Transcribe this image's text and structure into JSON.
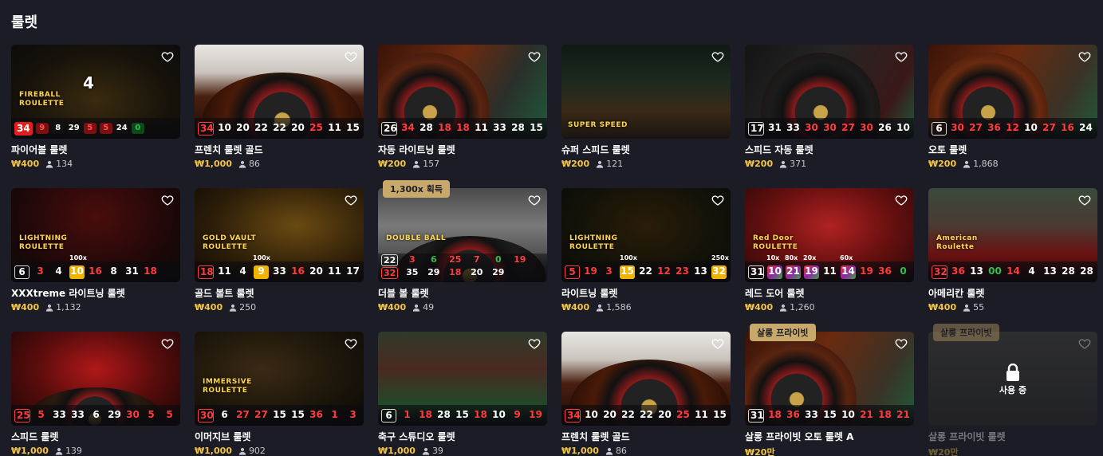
{
  "section_title": "룰렛",
  "colors": {
    "accent_gold": "#f4c542",
    "background": "#1b1c25",
    "red_number": "#ff3b3b",
    "green_number": "#2fbf4a"
  },
  "icons": {
    "favorite": "heart-outline-icon",
    "players": "user-icon",
    "lock": "lock-icon"
  },
  "games": [
    {
      "name": "파이어볼 룰렛",
      "price": "₩400",
      "players": "134",
      "results": [
        {
          "v": "34",
          "c": "redfill"
        },
        {
          "v": "9",
          "c": "red"
        },
        {
          "v": "8",
          "c": "black"
        },
        {
          "v": "29",
          "c": "black"
        },
        {
          "v": "5",
          "c": "red"
        },
        {
          "v": "5",
          "c": "red"
        },
        {
          "v": "24",
          "c": "black"
        },
        {
          "v": "0",
          "c": "green"
        }
      ],
      "thumb_text": [
        "FIREBALL",
        "ROULETTE",
        "4"
      ],
      "style": "boxed"
    },
    {
      "name": "프렌치 룰렛 골드",
      "price": "₩1,000",
      "players": "86",
      "results": [
        {
          "v": "34",
          "c": "red"
        },
        {
          "v": "10",
          "c": "black"
        },
        {
          "v": "20",
          "c": "black"
        },
        {
          "v": "22",
          "c": "black"
        },
        {
          "v": "22",
          "c": "black"
        },
        {
          "v": "20",
          "c": "black"
        },
        {
          "v": "25",
          "c": "red"
        },
        {
          "v": "11",
          "c": "black"
        },
        {
          "v": "15",
          "c": "black"
        }
      ]
    },
    {
      "name": "자동 라이트닝 룰렛",
      "price": "₩200",
      "players": "157",
      "results": [
        {
          "v": "26",
          "c": "black"
        },
        {
          "v": "34",
          "c": "red"
        },
        {
          "v": "28",
          "c": "black"
        },
        {
          "v": "18",
          "c": "red"
        },
        {
          "v": "18",
          "c": "red"
        },
        {
          "v": "11",
          "c": "black"
        },
        {
          "v": "33",
          "c": "black"
        },
        {
          "v": "28",
          "c": "black"
        },
        {
          "v": "15",
          "c": "black"
        }
      ]
    },
    {
      "name": "슈퍼 스피드 룰렛",
      "price": "₩200",
      "players": "121",
      "results": [],
      "thumb_text": [
        "SUPER SPEED"
      ]
    },
    {
      "name": "스피드 자동 룰렛",
      "price": "₩200",
      "players": "371",
      "results": [
        {
          "v": "17",
          "c": "black"
        },
        {
          "v": "31",
          "c": "black"
        },
        {
          "v": "33",
          "c": "black"
        },
        {
          "v": "30",
          "c": "red"
        },
        {
          "v": "30",
          "c": "red"
        },
        {
          "v": "27",
          "c": "red"
        },
        {
          "v": "30",
          "c": "red"
        },
        {
          "v": "26",
          "c": "black"
        },
        {
          "v": "10",
          "c": "black"
        }
      ]
    },
    {
      "name": "오토 룰렛",
      "price": "₩200",
      "players": "1,868",
      "results": [
        {
          "v": "6",
          "c": "black"
        },
        {
          "v": "30",
          "c": "red"
        },
        {
          "v": "27",
          "c": "red"
        },
        {
          "v": "36",
          "c": "red"
        },
        {
          "v": "12",
          "c": "red"
        },
        {
          "v": "10",
          "c": "black"
        },
        {
          "v": "27",
          "c": "red"
        },
        {
          "v": "16",
          "c": "red"
        },
        {
          "v": "24",
          "c": "black"
        }
      ]
    },
    {
      "name": "XXXtreme 라이트닝 룰렛",
      "price": "₩400",
      "players": "1,132",
      "results": [
        {
          "v": "6",
          "c": "black"
        },
        {
          "v": "3",
          "c": "red"
        },
        {
          "v": "4",
          "c": "black"
        },
        {
          "v": "10",
          "c": "gold",
          "m": "100x"
        },
        {
          "v": "16",
          "c": "red"
        },
        {
          "v": "8",
          "c": "black"
        },
        {
          "v": "31",
          "c": "black"
        },
        {
          "v": "18",
          "c": "red"
        }
      ],
      "thumb_text": [
        "LIGHTNING",
        "ROULETTE"
      ]
    },
    {
      "name": "골드 볼트 룰렛",
      "price": "₩400",
      "players": "250",
      "results": [
        {
          "v": "18",
          "c": "red"
        },
        {
          "v": "11",
          "c": "black"
        },
        {
          "v": "4",
          "c": "black"
        },
        {
          "v": "9",
          "c": "gold",
          "m": "100x"
        },
        {
          "v": "33",
          "c": "black"
        },
        {
          "v": "16",
          "c": "red"
        },
        {
          "v": "20",
          "c": "black"
        },
        {
          "v": "11",
          "c": "black"
        },
        {
          "v": "17",
          "c": "black"
        }
      ],
      "thumb_text": [
        "GOLD VAULT",
        "ROULETTE"
      ]
    },
    {
      "name": "더블 볼 룰렛",
      "price": "₩400",
      "players": "49",
      "badge": "1,300x 획득",
      "results_double": [
        [
          {
            "v": "22",
            "c": "black"
          },
          {
            "v": "3",
            "c": "red"
          },
          {
            "v": "6",
            "c": "green"
          },
          {
            "v": "25",
            "c": "red"
          },
          {
            "v": "7",
            "c": "red"
          },
          {
            "v": "0",
            "c": "green"
          },
          {
            "v": "19",
            "c": "red"
          }
        ],
        [
          {
            "v": "32",
            "c": "red"
          },
          {
            "v": "35",
            "c": "black"
          },
          {
            "v": "29",
            "c": "black"
          },
          {
            "v": "18",
            "c": "red"
          },
          {
            "v": "20",
            "c": "black"
          },
          {
            "v": "29",
            "c": "black"
          }
        ]
      ],
      "thumb_text": [
        "DOUBLE BALL"
      ]
    },
    {
      "name": "라이트닝 룰렛",
      "price": "₩400",
      "players": "1,586",
      "results": [
        {
          "v": "5",
          "c": "red"
        },
        {
          "v": "19",
          "c": "red"
        },
        {
          "v": "3",
          "c": "red"
        },
        {
          "v": "15",
          "c": "gold",
          "m": "100x"
        },
        {
          "v": "22",
          "c": "black"
        },
        {
          "v": "12",
          "c": "red"
        },
        {
          "v": "23",
          "c": "red"
        },
        {
          "v": "13",
          "c": "black"
        },
        {
          "v": "32",
          "c": "gold",
          "m": "250x"
        }
      ],
      "thumb_text": [
        "LIGHTNING",
        "ROULETTE"
      ]
    },
    {
      "name": "레드 도어 룰렛",
      "price": "₩400",
      "players": "1,260",
      "results": [
        {
          "v": "31",
          "c": "black"
        },
        {
          "v": "10",
          "c": "multi",
          "m": "10x"
        },
        {
          "v": "21",
          "c": "multi",
          "m": "80x"
        },
        {
          "v": "19",
          "c": "multi",
          "m": "20x"
        },
        {
          "v": "11",
          "c": "black"
        },
        {
          "v": "14",
          "c": "multi",
          "m": "60x"
        },
        {
          "v": "19",
          "c": "red"
        },
        {
          "v": "36",
          "c": "red"
        },
        {
          "v": "0",
          "c": "green"
        }
      ],
      "thumb_text": [
        "Red Door",
        "ROULETTE"
      ]
    },
    {
      "name": "아메리칸 룰렛",
      "price": "₩400",
      "players": "55",
      "results": [
        {
          "v": "32",
          "c": "red"
        },
        {
          "v": "36",
          "c": "red"
        },
        {
          "v": "13",
          "c": "black"
        },
        {
          "v": "00",
          "c": "green"
        },
        {
          "v": "14",
          "c": "red"
        },
        {
          "v": "4",
          "c": "black"
        },
        {
          "v": "13",
          "c": "black"
        },
        {
          "v": "28",
          "c": "black"
        },
        {
          "v": "28",
          "c": "black"
        }
      ],
      "thumb_text": [
        "American",
        "Roulette"
      ]
    },
    {
      "name": "스피드 룰렛",
      "price": "₩1,000",
      "players": "139",
      "results": [
        {
          "v": "25",
          "c": "red"
        },
        {
          "v": "5",
          "c": "red"
        },
        {
          "v": "33",
          "c": "black"
        },
        {
          "v": "33",
          "c": "black"
        },
        {
          "v": "6",
          "c": "black"
        },
        {
          "v": "29",
          "c": "black"
        },
        {
          "v": "30",
          "c": "red"
        },
        {
          "v": "5",
          "c": "red"
        },
        {
          "v": "5",
          "c": "red"
        }
      ]
    },
    {
      "name": "이머지브 룰렛",
      "price": "₩1,000",
      "players": "902",
      "results": [
        {
          "v": "30",
          "c": "red"
        },
        {
          "v": "6",
          "c": "black"
        },
        {
          "v": "27",
          "c": "red"
        },
        {
          "v": "27",
          "c": "red"
        },
        {
          "v": "15",
          "c": "black"
        },
        {
          "v": "15",
          "c": "black"
        },
        {
          "v": "36",
          "c": "red"
        },
        {
          "v": "1",
          "c": "red"
        },
        {
          "v": "3",
          "c": "red"
        }
      ],
      "thumb_text": [
        "IMMERSIVE",
        "ROULETTE"
      ]
    },
    {
      "name": "축구 스튜디오 룰렛",
      "price": "₩1,000",
      "players": "39",
      "results": [
        {
          "v": "6",
          "c": "black"
        },
        {
          "v": "1",
          "c": "red"
        },
        {
          "v": "18",
          "c": "red"
        },
        {
          "v": "28",
          "c": "black"
        },
        {
          "v": "15",
          "c": "black"
        },
        {
          "v": "18",
          "c": "red"
        },
        {
          "v": "10",
          "c": "black"
        },
        {
          "v": "9",
          "c": "red"
        },
        {
          "v": "19",
          "c": "red"
        }
      ]
    },
    {
      "name": "프렌치 룰렛 골드",
      "price": "₩1,000",
      "players": "86",
      "results": [
        {
          "v": "34",
          "c": "red"
        },
        {
          "v": "10",
          "c": "black"
        },
        {
          "v": "20",
          "c": "black"
        },
        {
          "v": "22",
          "c": "black"
        },
        {
          "v": "22",
          "c": "black"
        },
        {
          "v": "20",
          "c": "black"
        },
        {
          "v": "25",
          "c": "red"
        },
        {
          "v": "11",
          "c": "black"
        },
        {
          "v": "15",
          "c": "black"
        }
      ]
    },
    {
      "name": "살롱 프라이빗 오토 룰렛 A",
      "price": "₩20만",
      "players": "",
      "badge": "살롱 프라이빗",
      "results": [
        {
          "v": "31",
          "c": "black"
        },
        {
          "v": "18",
          "c": "red"
        },
        {
          "v": "36",
          "c": "red"
        },
        {
          "v": "33",
          "c": "black"
        },
        {
          "v": "15",
          "c": "black"
        },
        {
          "v": "10",
          "c": "black"
        },
        {
          "v": "21",
          "c": "red"
        },
        {
          "v": "18",
          "c": "red"
        },
        {
          "v": "21",
          "c": "red"
        }
      ]
    },
    {
      "name": "살롱 프라이빗 룰렛",
      "price": "₩20만",
      "players": "",
      "badge": "살롱 프라이빗",
      "locked": true,
      "lock_label": "사용 중",
      "results": []
    }
  ]
}
